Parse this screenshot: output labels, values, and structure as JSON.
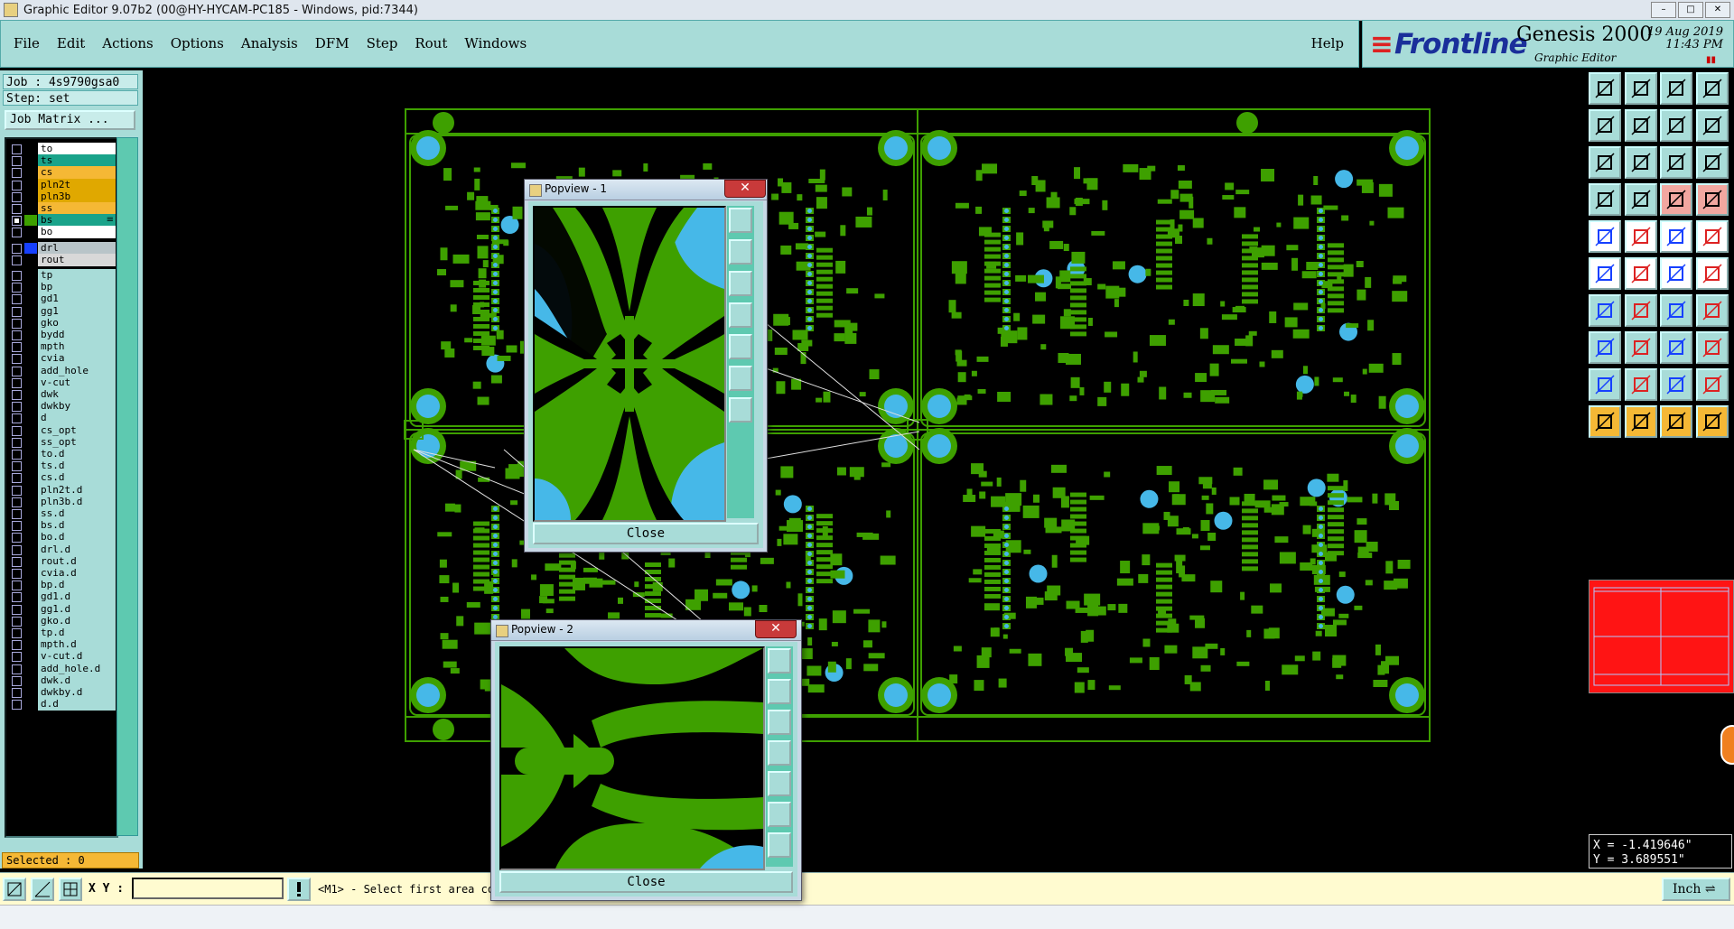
{
  "window": {
    "title": "Graphic Editor 9.07b2 (00@HY-HYCAM-PC185 - Windows, pid:7344)",
    "controls": [
      "–",
      "□",
      "✕"
    ]
  },
  "menu": {
    "items": [
      "File",
      "Edit",
      "Actions",
      "Options",
      "Analysis",
      "DFM",
      "Step",
      "Rout",
      "Windows"
    ],
    "help": "Help"
  },
  "brand": {
    "logo": "Frontline",
    "product": "Genesis 2000",
    "subtitle": "Graphic Editor",
    "date": "19 Aug 2019",
    "time": "11:43 PM"
  },
  "job": {
    "job_line": "Job : 4s9790gsa0",
    "step_line": "Step: set",
    "matrix_button": "Job Matrix ..."
  },
  "layers": [
    {
      "name": "to",
      "bg": "#ffffff",
      "checked": false,
      "swatch": "#000000"
    },
    {
      "name": "ts",
      "bg": "#1aa38a",
      "checked": false,
      "swatch": "#000000"
    },
    {
      "name": "cs",
      "bg": "#f5b835",
      "checked": false,
      "swatch": "#000000"
    },
    {
      "name": "pln2t",
      "bg": "#e0a800",
      "checked": false,
      "swatch": "#000000"
    },
    {
      "name": "pln3b",
      "bg": "#e0a800",
      "checked": false,
      "swatch": "#000000"
    },
    {
      "name": "ss",
      "bg": "#f5b835",
      "checked": false,
      "swatch": "#000000"
    },
    {
      "name": "bs",
      "bg": "#1aa38a",
      "checked": true,
      "swatch": "#3ea000",
      "marker": "≡"
    },
    {
      "name": "bo",
      "bg": "#ffffff",
      "checked": false,
      "swatch": "#000000"
    },
    {
      "name": "drl",
      "bg": "#b8c4c8",
      "checked": false,
      "swatch": "#1640ff"
    },
    {
      "name": "rout",
      "bg": "#d8d8d8",
      "checked": false,
      "swatch": "#000000"
    },
    {
      "name": "tp",
      "bg": "#a8dcd8"
    },
    {
      "name": "bp",
      "bg": "#a8dcd8"
    },
    {
      "name": "gd1",
      "bg": "#a8dcd8"
    },
    {
      "name": "gg1",
      "bg": "#a8dcd8"
    },
    {
      "name": "gko",
      "bg": "#a8dcd8"
    },
    {
      "name": "bydd",
      "bg": "#a8dcd8"
    },
    {
      "name": "mpth",
      "bg": "#a8dcd8"
    },
    {
      "name": "cvia",
      "bg": "#a8dcd8"
    },
    {
      "name": "add_hole",
      "bg": "#a8dcd8"
    },
    {
      "name": "v-cut",
      "bg": "#a8dcd8"
    },
    {
      "name": "dwk",
      "bg": "#a8dcd8"
    },
    {
      "name": "dwkby",
      "bg": "#a8dcd8"
    },
    {
      "name": "d",
      "bg": "#a8dcd8"
    },
    {
      "name": "cs_opt",
      "bg": "#a8dcd8"
    },
    {
      "name": "ss_opt",
      "bg": "#a8dcd8"
    },
    {
      "name": "to.d",
      "bg": "#a8dcd8"
    },
    {
      "name": "ts.d",
      "bg": "#a8dcd8"
    },
    {
      "name": "cs.d",
      "bg": "#a8dcd8"
    },
    {
      "name": "pln2t.d",
      "bg": "#a8dcd8"
    },
    {
      "name": "pln3b.d",
      "bg": "#a8dcd8"
    },
    {
      "name": "ss.d",
      "bg": "#a8dcd8"
    },
    {
      "name": "bs.d",
      "bg": "#a8dcd8"
    },
    {
      "name": "bo.d",
      "bg": "#a8dcd8"
    },
    {
      "name": "drl.d",
      "bg": "#a8dcd8"
    },
    {
      "name": "rout.d",
      "bg": "#a8dcd8"
    },
    {
      "name": "cvia.d",
      "bg": "#a8dcd8"
    },
    {
      "name": "bp.d",
      "bg": "#a8dcd8"
    },
    {
      "name": "gd1.d",
      "bg": "#a8dcd8"
    },
    {
      "name": "gg1.d",
      "bg": "#a8dcd8"
    },
    {
      "name": "gko.d",
      "bg": "#a8dcd8"
    },
    {
      "name": "tp.d",
      "bg": "#a8dcd8"
    },
    {
      "name": "mpth.d",
      "bg": "#a8dcd8"
    },
    {
      "name": "v-cut.d",
      "bg": "#a8dcd8"
    },
    {
      "name": "add_hole.d",
      "bg": "#a8dcd8"
    },
    {
      "name": "dwk.d",
      "bg": "#a8dcd8"
    },
    {
      "name": "dwkby.d",
      "bg": "#a8dcd8"
    },
    {
      "name": "d.d",
      "bg": "#a8dcd8"
    }
  ],
  "selected": "Selected : 0",
  "popviews": [
    {
      "title": "Popview - 1",
      "close_label": "Close"
    },
    {
      "title": "Popview - 2",
      "close_label": "Close"
    }
  ],
  "coords": {
    "x": "X = -1.419646\"",
    "y": "Y = 3.689551\""
  },
  "status": {
    "xy_label": "X Y :",
    "xy_value": "",
    "prompt": "<M1> - Select first area co",
    "units": "Inch"
  },
  "colors": {
    "panel": "#a8dcd8",
    "copper": "#3ea000",
    "drill": "#46b8e8",
    "minimap": "#ff1414"
  }
}
